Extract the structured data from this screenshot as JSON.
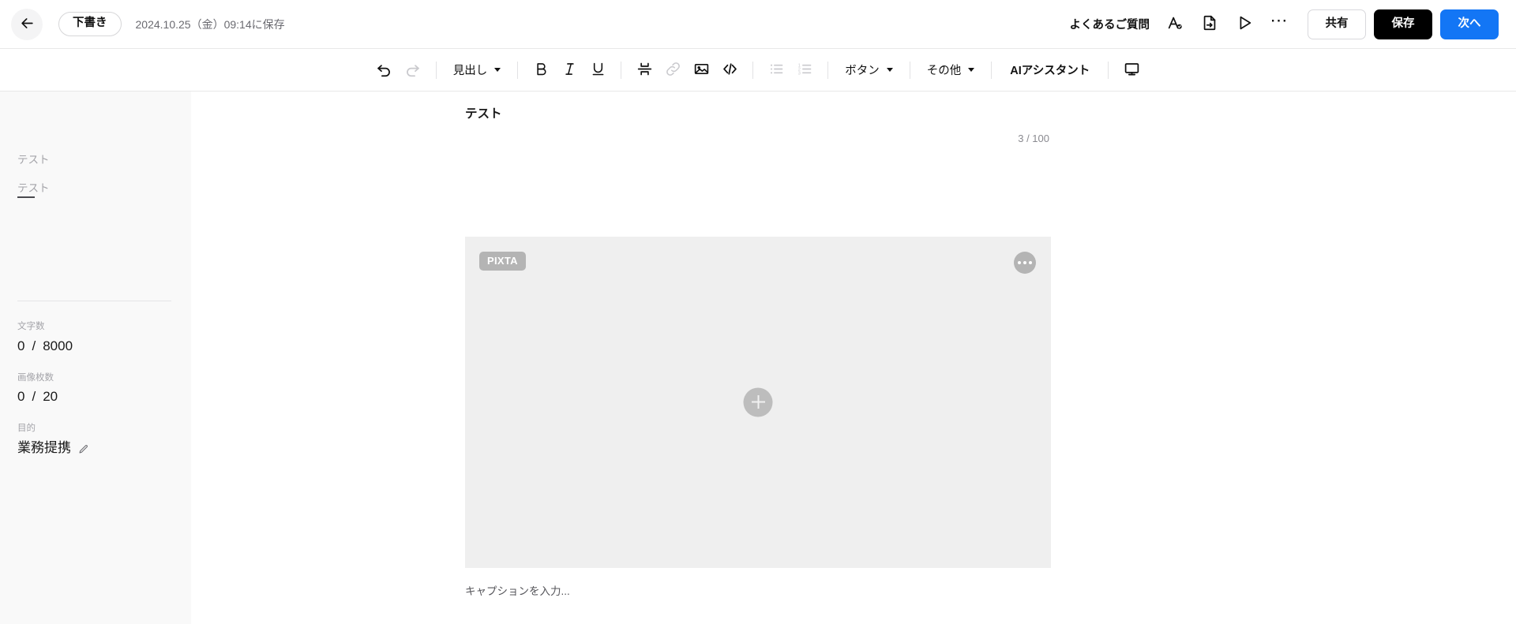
{
  "header": {
    "back_icon": "arrow-left-icon",
    "status_badge": "下書き",
    "saved_text": "2024.10.25（金）09:14に保存",
    "faq_label": "よくあるご質問",
    "spellcheck_icon": "spellcheck-icon",
    "export_icon": "file-export-icon",
    "preview_icon": "play-preview-icon",
    "more_icon": "more-horizontal-icon",
    "share_label": "共有",
    "save_label": "保存",
    "next_label": "次へ",
    "accent_color": "#1376f5",
    "save_bg_color": "#000000"
  },
  "toolbar": {
    "undo_icon": "undo-icon",
    "redo_icon": "redo-icon",
    "heading_label": "見出し",
    "bold_icon": "bold-icon",
    "italic_icon": "italic-icon",
    "underline_icon": "underline-icon",
    "divider_icon": "horizontal-rule-icon",
    "link_icon": "link-icon",
    "image_icon": "image-icon",
    "code_icon": "code-icon",
    "bullet_list_icon": "bullet-list-icon",
    "ordered_list_icon": "ordered-list-icon",
    "button_label": "ボタン",
    "other_label": "その他",
    "ai_assistant_label": "AIアシスタント",
    "monitor_icon": "monitor-preview-icon"
  },
  "sidebar": {
    "outline": [
      {
        "label": "テスト"
      },
      {
        "label": "テスト"
      }
    ],
    "char_count": {
      "label": "文字数",
      "current": "0",
      "separator": "/",
      "max": "8000"
    },
    "image_count": {
      "label": "画像枚数",
      "current": "0",
      "separator": "/",
      "max": "20"
    },
    "purpose": {
      "label": "目的",
      "value": "業務提携",
      "edit_icon": "pencil-edit-icon"
    }
  },
  "main": {
    "doc_title": "テスト",
    "title_counter": "3 / 100",
    "image_block": {
      "badge": "PIXTA",
      "more_icon": "more-horizontal-icon",
      "add_icon": "plus-icon",
      "placeholder_color": "#efefef"
    },
    "caption_placeholder": "キャプションを入力..."
  }
}
